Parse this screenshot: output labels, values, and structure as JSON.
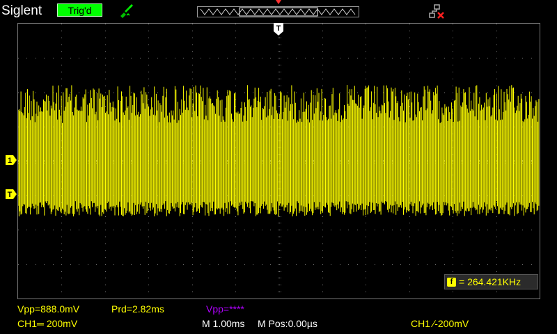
{
  "header": {
    "brand": "Siglent",
    "trigger_status": "Trig'd"
  },
  "measurements": {
    "vpp_ch1": "Vpp=888.0mV",
    "period": "Prd=2.82ms",
    "vpp_ch2": "Vpp=****",
    "frequency": "= 264.421KHz"
  },
  "settings": {
    "ch1_scale": "CH1═ 200mV",
    "timebase": "M 1.00ms",
    "horizontal_position": "M Pos:0.00µs",
    "trigger_setting": "CH1 ∕-200mV"
  },
  "markers": {
    "channel": "1",
    "trigger_level": "T",
    "trigger_position": "T",
    "freq_icon": "f"
  },
  "colors": {
    "channel1": "#ffff00",
    "math": "#b000ff",
    "trig_status": "#00ff00",
    "grid": "#8a8a8a"
  }
}
